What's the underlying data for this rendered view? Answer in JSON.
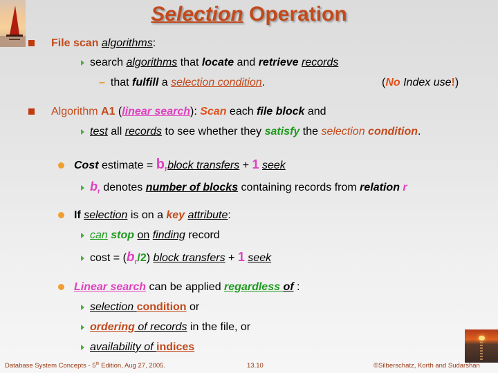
{
  "title": {
    "part1": "Selection",
    "part2": " Operation"
  },
  "l1": {
    "a": "File scan ",
    "b": "algorithms",
    "c": ":"
  },
  "l2": {
    "a": "search ",
    "b": "algorithms",
    "c": " that ",
    "d": "locate",
    "e": " and ",
    "f": "retrieve",
    "g": " ",
    "h": "records"
  },
  "l3": {
    "a": "that ",
    "b": "fulfill",
    "c": " a ",
    "d": "selection condition",
    "e": "."
  },
  "note": {
    "a": "(",
    "b": "No",
    "c": " Index use",
    "d": "!",
    "e": ")"
  },
  "l4": {
    "a": "Algorithm ",
    "b": "A1",
    "c": " (",
    "d": "linear search",
    "e": "):  ",
    "f": "Scan",
    "g": " each ",
    "h": "file block",
    "i": " and"
  },
  "l5": {
    "a": "test",
    "b": " all ",
    "c": "records",
    "d": " to see whether they ",
    "e": "satisfy",
    "f": " the ",
    "g": "selection",
    "h": " ",
    "i": "condition",
    "j": "."
  },
  "l6": {
    "a": "Cost",
    "b": " estimate = ",
    "c": "b",
    "d": "r",
    "e": "block transfers",
    "f": " + ",
    "g": "1",
    "h": " ",
    "i": "seek"
  },
  "l7": {
    "a": "b",
    "b": "r",
    "c": "  denotes ",
    "d": "number of blocks",
    "e": " containing records from ",
    "f": "relation",
    "g": " r"
  },
  "l8": {
    "a": "If ",
    "b": "selection",
    "c": " is on a ",
    "d": "key",
    "e": " ",
    "f": "attribute",
    "g": ":"
  },
  "l9": {
    "a": "can",
    "b": " ",
    "c": "stop",
    "d": " ",
    "e": "on",
    "f": " ",
    "g": "finding",
    "h": " record"
  },
  "l10": {
    "a": "cost = (",
    "b": "b",
    "c": "r",
    "d": "/2",
    "e": ") ",
    "f": "block transfers",
    "g": " + ",
    "h": "1",
    "i": " ",
    "j": "seek"
  },
  "l11": {
    "a": "Linear search",
    "b": " can be applied ",
    "c": "regardless ",
    "d": "of",
    "e": " :"
  },
  "l12": {
    "a": "selection ",
    "b": "condition",
    "c": " or"
  },
  "l13": {
    "a": "ordering",
    "b": " of records",
    "c": " in the file, or"
  },
  "l14": {
    "a": "availability of ",
    "b": "indices"
  },
  "footer": {
    "left_a": "Database System Concepts - 5",
    "left_sup": "th",
    "left_b": " Edition, Aug 27, 2005.",
    "center": "13.10",
    "right": "©Silberschatz, Korth and Sudarshan"
  },
  "colors": {
    "title": "#c24a1c",
    "accent_red": "#c24a1c",
    "green": "#1e9a1e",
    "pink": "#e040c0",
    "bullet_orange": "#f0a030"
  }
}
